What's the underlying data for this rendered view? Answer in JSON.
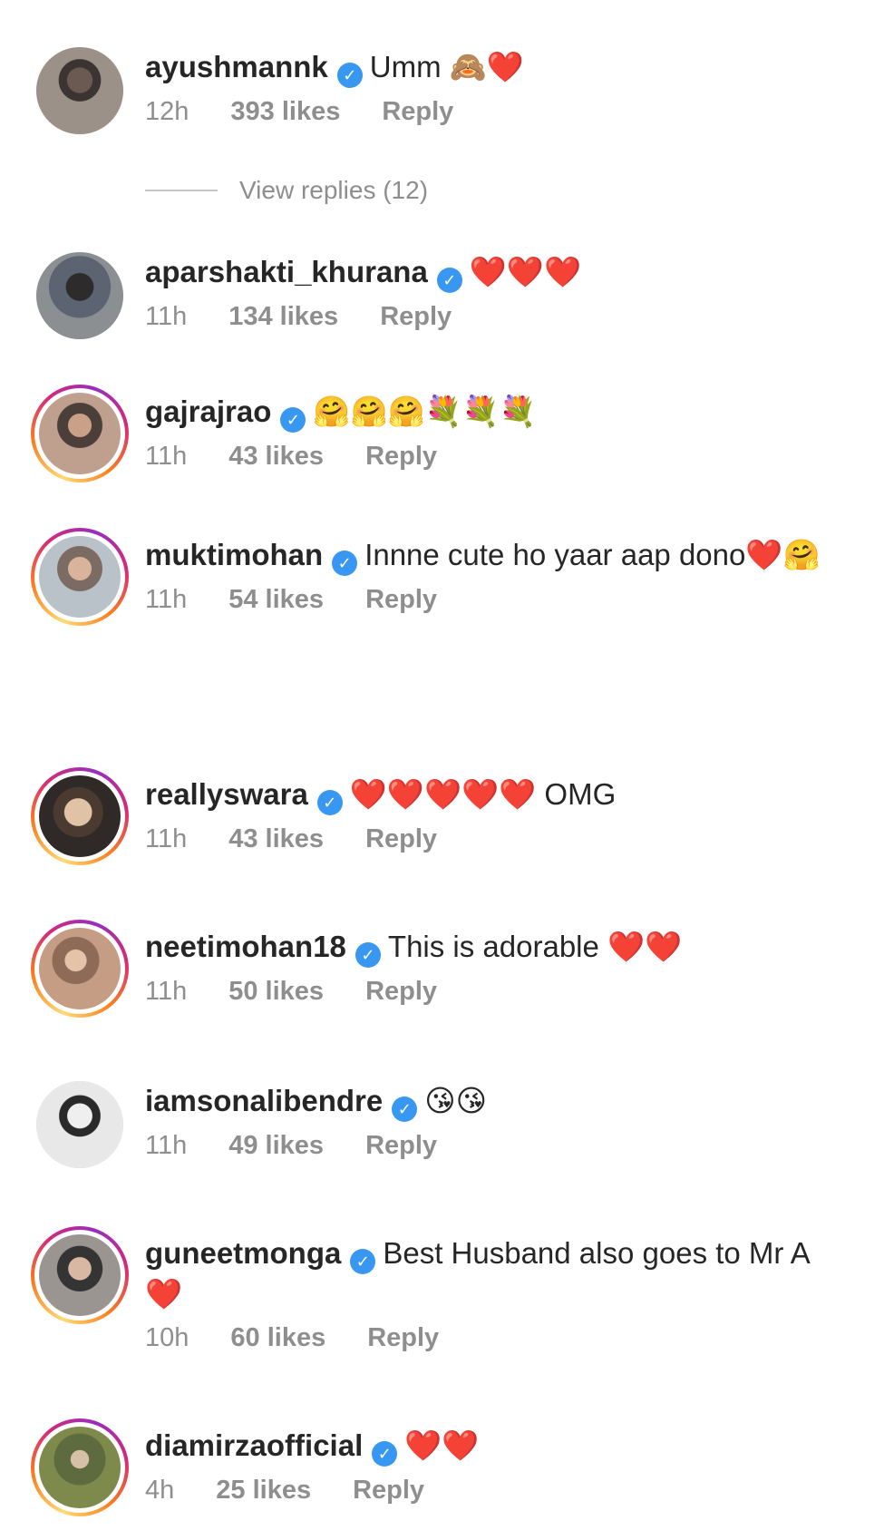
{
  "comments": [
    {
      "username": "ayushmannk",
      "text": "Umm 🙈❤️",
      "time": "12h",
      "likes": "393 likes",
      "reply": "Reply",
      "story_ring": false
    },
    {
      "username": "aparshakti_khurana",
      "text": "❤️❤️❤️",
      "time": "11h",
      "likes": "134 likes",
      "reply": "Reply",
      "story_ring": false
    },
    {
      "username": "gajrajrao",
      "text": "🤗🤗🤗💐💐💐",
      "time": "11h",
      "likes": "43 likes",
      "reply": "Reply",
      "story_ring": true
    },
    {
      "username": "muktimohan",
      "text": "Innne cute ho yaar aap dono❤️🤗",
      "time": "11h",
      "likes": "54 likes",
      "reply": "Reply",
      "story_ring": true
    },
    {
      "username": "reallyswara",
      "text": "❤️❤️❤️❤️❤️ OMG",
      "time": "11h",
      "likes": "43 likes",
      "reply": "Reply",
      "story_ring": true
    },
    {
      "username": "neetimohan18",
      "text": "This is adorable ❤️❤️",
      "time": "11h",
      "likes": "50 likes",
      "reply": "Reply",
      "story_ring": true
    },
    {
      "username": "iamsonalibendre",
      "text": "😘😘",
      "time": "11h",
      "likes": "49 likes",
      "reply": "Reply",
      "story_ring": false
    },
    {
      "username": "guneetmonga",
      "text": "Best Husband also goes to Mr A ❤️",
      "time": "10h",
      "likes": "60 likes",
      "reply": "Reply",
      "story_ring": true
    },
    {
      "username": "diamirzaofficial",
      "text": "❤️❤️",
      "time": "4h",
      "likes": "25 likes",
      "reply": "Reply",
      "story_ring": true
    }
  ],
  "view_replies": "View replies (12)",
  "colors": {
    "verified": "#3897f0",
    "meta_text": "#8e8e8e",
    "primary_text": "#262626"
  }
}
